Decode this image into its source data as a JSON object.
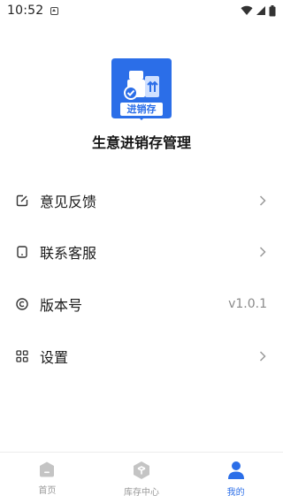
{
  "status_bar": {
    "time": "10:52",
    "icons": [
      "notification-icon",
      "wifi-icon",
      "signal-icon",
      "battery-icon"
    ]
  },
  "app": {
    "logo_text": "进销存",
    "name": "生意进销存管理"
  },
  "menu": {
    "items": [
      {
        "label": "意见反馈",
        "icon": "edit-icon",
        "chevron": true
      },
      {
        "label": "联系客服",
        "icon": "phone-icon",
        "chevron": true
      },
      {
        "label": "版本号",
        "icon": "copyright-icon",
        "value": "v1.0.1"
      },
      {
        "label": "设置",
        "icon": "grid-icon",
        "chevron": true
      }
    ]
  },
  "tab_bar": {
    "tabs": [
      {
        "label": "首页",
        "icon": "home-icon",
        "active": false
      },
      {
        "label": "库存中心",
        "icon": "box-icon",
        "active": false
      },
      {
        "label": "我的",
        "icon": "user-icon",
        "active": true
      }
    ]
  },
  "colors": {
    "accent": "#2b6ee8",
    "inactive": "#c4c4c4",
    "value_text": "#8a8a8a"
  }
}
